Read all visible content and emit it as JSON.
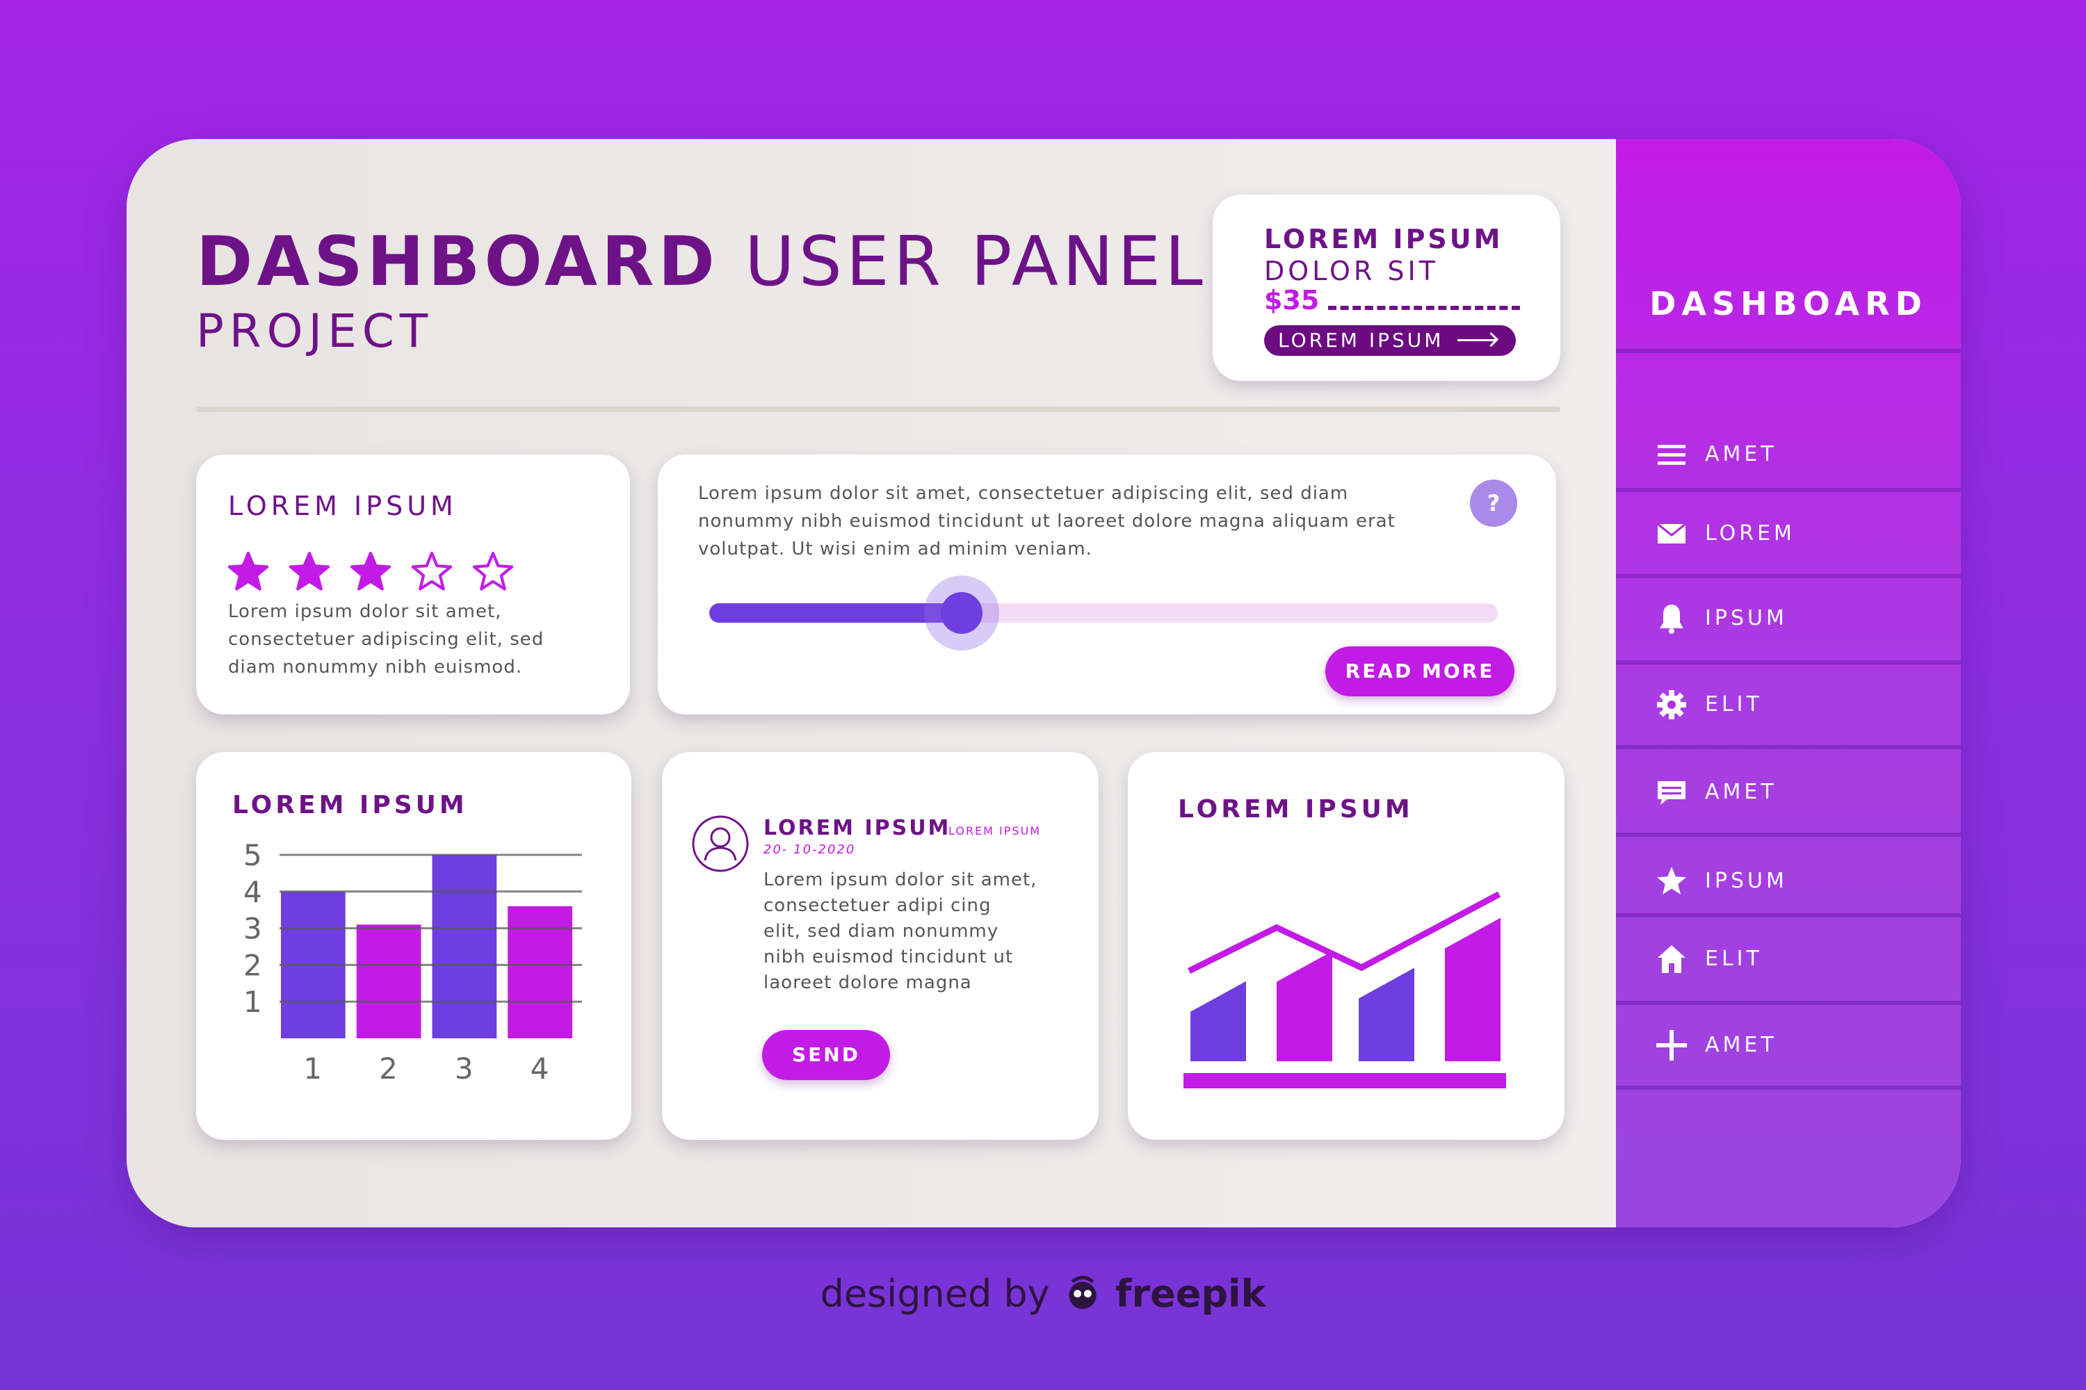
{
  "header": {
    "title_bold": "DASHBOARD",
    "title_rest": "USER PANEL",
    "subtitle": "PROJECT"
  },
  "promo": {
    "title": "LOREM IPSUM",
    "subtitle": "DOLOR SIT",
    "price": "$35",
    "button_label": "LOREM IPSUM"
  },
  "rating_card": {
    "title": "LOREM IPSUM",
    "rating": 3,
    "max_rating": 5,
    "text_lines": [
      "Lorem ipsum dolor sit amet,",
      "consectetuer adipiscing elit, sed",
      "diam nonummy nibh euismod."
    ]
  },
  "slider_card": {
    "text_lines": [
      "Lorem ipsum dolor sit amet, consectetuer adipiscing elit, sed diam",
      "nonummy nibh euismod tincidunt ut laoreet dolore magna aliquam erat",
      "volutpat. Ut wisi enim ad minim veniam."
    ],
    "help_label": "?",
    "slider_value": 0.32,
    "button_label": "READ MORE"
  },
  "bar_card": {
    "title": "LOREM IPSUM"
  },
  "message_card": {
    "name": "LOREM IPSUM",
    "tag": "LOREM IPSUM",
    "date": "20- 10-2020",
    "text_lines": [
      "Lorem ipsum dolor sit amet,",
      "consectetuer adipi  cing",
      "elit, sed diam nonummy",
      "nibh euismod tincidunt ut",
      "laoreet dolore magna"
    ],
    "button_label": "SEND"
  },
  "trend_card": {
    "title": "LOREM IPSUM"
  },
  "sidebar": {
    "title": "DASHBOARD",
    "items": [
      {
        "label": "AMET",
        "icon": "menu-icon"
      },
      {
        "label": "LOREM",
        "icon": "mail-icon"
      },
      {
        "label": "IPSUM",
        "icon": "bell-icon"
      },
      {
        "label": "ELIT",
        "icon": "gear-icon"
      },
      {
        "label": "AMET",
        "icon": "chat-icon"
      },
      {
        "label": "IPSUM",
        "icon": "star-icon"
      },
      {
        "label": "ELIT",
        "icon": "home-icon"
      },
      {
        "label": "AMET",
        "icon": "plus-icon"
      }
    ]
  },
  "credit": {
    "prefix": "designed by",
    "brand": "freepik"
  },
  "colors": {
    "primary_purple": "#6e1288",
    "magenta": "#c21be6",
    "violet": "#6f3ee0"
  },
  "chart_data": [
    {
      "type": "bar",
      "categories": [
        "1",
        "2",
        "3",
        "4"
      ],
      "values": [
        4,
        3.1,
        5,
        3.6
      ],
      "yticks": [
        1,
        2,
        3,
        4,
        5
      ],
      "ylim": [
        0,
        5
      ],
      "grid": true,
      "title": "LOREM IPSUM"
    },
    {
      "type": "bar",
      "categories": [
        "",
        "",
        "",
        ""
      ],
      "values": [
        2.4,
        3.3,
        2.8,
        4.3
      ],
      "trend_line": [
        2.5,
        3.8,
        2.6,
        4.8
      ],
      "title": "LOREM IPSUM"
    }
  ]
}
